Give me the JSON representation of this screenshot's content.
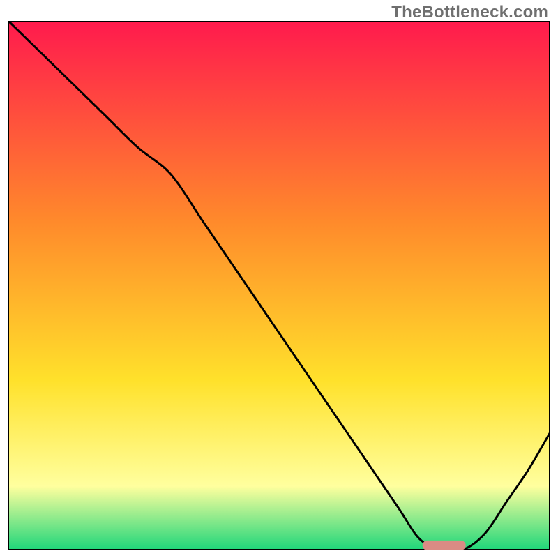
{
  "watermark": "TheBottleneck.com",
  "chart_data": {
    "type": "line",
    "title": "",
    "xlabel": "",
    "ylabel": "",
    "xlim": [
      0,
      1
    ],
    "ylim": [
      0,
      1
    ],
    "grid": false,
    "series": [
      {
        "name": "bottleneck_curve",
        "x": [
          0.0,
          0.06,
          0.12,
          0.18,
          0.24,
          0.3,
          0.36,
          0.42,
          0.48,
          0.54,
          0.6,
          0.66,
          0.72,
          0.76,
          0.8,
          0.84,
          0.88,
          0.92,
          0.96,
          1.0
        ],
        "y": [
          1.0,
          0.94,
          0.88,
          0.82,
          0.76,
          0.71,
          0.62,
          0.53,
          0.44,
          0.35,
          0.26,
          0.17,
          0.08,
          0.02,
          0.0,
          0.0,
          0.03,
          0.09,
          0.15,
          0.22
        ],
        "color": "#000000"
      }
    ],
    "min_marker": {
      "note": "salmon rounded bar marking the minimum region of the curve",
      "x_start": 0.765,
      "x_end": 0.845,
      "y": 0.008,
      "color": "#d98b84"
    },
    "background_gradient": {
      "top": "#ff1a4d",
      "mid1": "#ff8a2b",
      "mid2": "#ffe12b",
      "mid3": "#ffff9e",
      "bottom": "#1fd67a"
    }
  }
}
